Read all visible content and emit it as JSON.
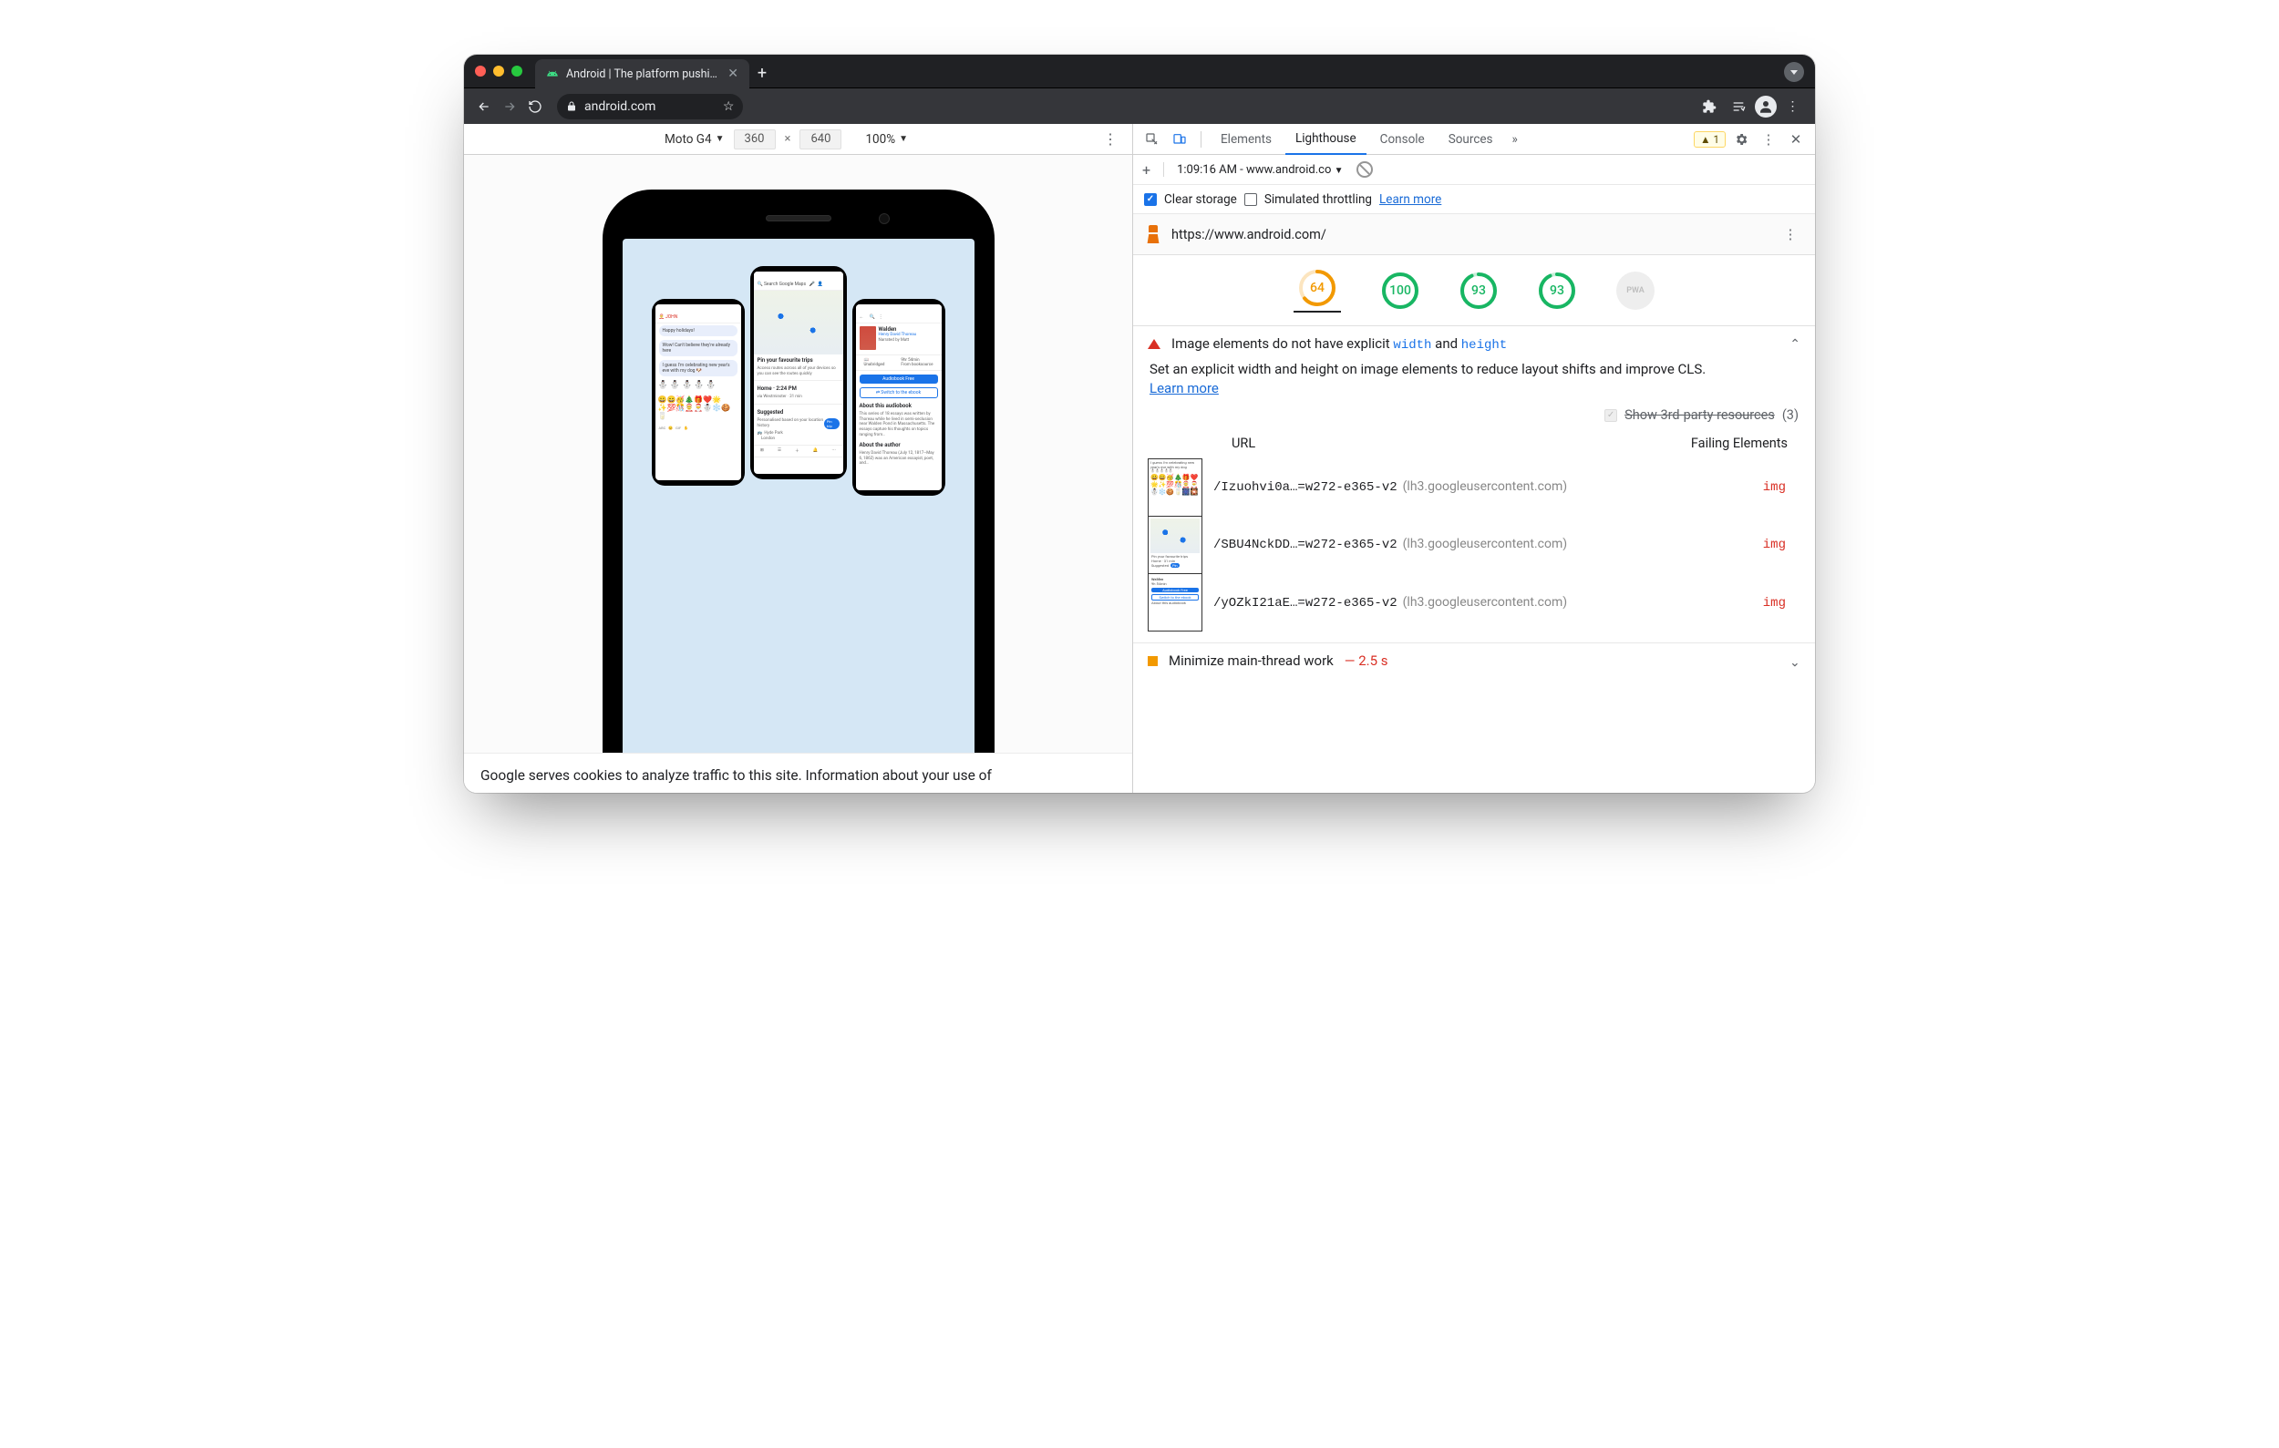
{
  "tab": {
    "title": "Android | The platform pushing"
  },
  "address": {
    "url": "android.com"
  },
  "device_toolbar": {
    "device": "Moto G4",
    "width": "360",
    "height": "640",
    "zoom": "100%"
  },
  "cookie_text": "Google serves cookies to analyze traffic to this site. Information about your use of",
  "devtools": {
    "tabs": [
      "Elements",
      "Lighthouse",
      "Console",
      "Sources"
    ],
    "active_tab": "Lighthouse",
    "more_tabs_glyph": "»",
    "warning_count": "1",
    "run_info": "1:09:16 AM - www.android.co",
    "clear_storage_label": "Clear storage",
    "simulated_label": "Simulated throttling",
    "learn_more_label": "Learn more",
    "audited_url": "https://www.android.com/",
    "scores": [
      {
        "value": "64",
        "pct": 0.64,
        "color": "#f29900",
        "active": true
      },
      {
        "value": "100",
        "pct": 1.0,
        "color": "#18b663"
      },
      {
        "value": "93",
        "pct": 0.93,
        "color": "#18b663"
      },
      {
        "value": "93",
        "pct": 0.93,
        "color": "#18b663"
      }
    ],
    "pwa_label": "PWA",
    "audit": {
      "title_pre": "Image elements do not have explicit",
      "title_code1": "width",
      "title_mid": " and ",
      "title_code2": "height",
      "desc": "Set an explicit width and height on image elements to reduce layout shifts and improve CLS.",
      "third_party_label": "Show 3rd-party resources",
      "third_party_count": "(3)",
      "col_url": "URL",
      "col_failing": "Failing Elements",
      "rows": [
        {
          "path": "/Izuohvi0a…=w272-e365-v2",
          "domain": "(lh3.googleusercontent.com)",
          "elem": "img"
        },
        {
          "path": "/SBU4NckDD…=w272-e365-v2",
          "domain": "(lh3.googleusercontent.com)",
          "elem": "img"
        },
        {
          "path": "/yOZkI21aE…=w272-e365-v2",
          "domain": "(lh3.googleusercontent.com)",
          "elem": "img"
        }
      ]
    },
    "audit2": {
      "title": "Minimize main-thread work",
      "value": "2.5 s"
    }
  }
}
